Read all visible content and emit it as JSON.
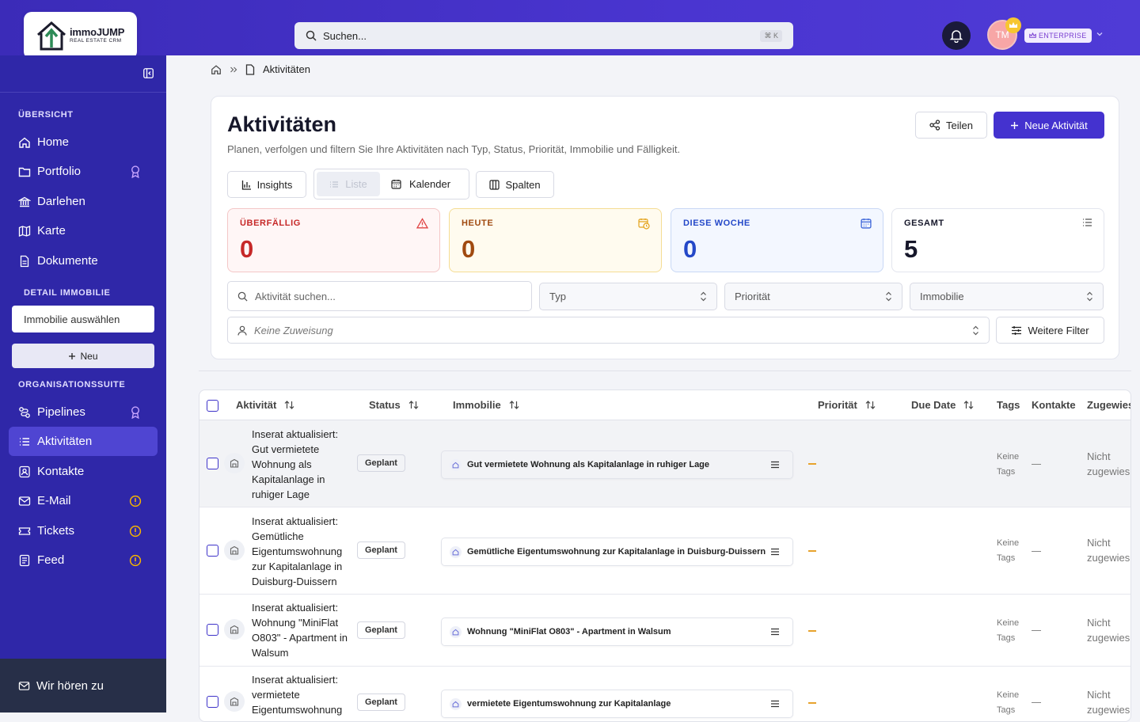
{
  "app": {
    "logo_text": "immoJUMP",
    "logo_subtext": "REAL ESTATE CRM"
  },
  "topbar": {
    "search_placeholder": "Suchen...",
    "search_shortcut": "⌘ K",
    "avatar_initials": "TM",
    "plan_badge": "ENTERPRISE"
  },
  "sidebar": {
    "section_overview": "ÜBERSICHT",
    "overview_items": [
      {
        "label": "Home",
        "icon": "home-icon"
      },
      {
        "label": "Portfolio",
        "icon": "folder-icon",
        "badge": "premium"
      },
      {
        "label": "Darlehen",
        "icon": "bank-icon"
      },
      {
        "label": "Karte",
        "icon": "map-icon"
      },
      {
        "label": "Dokumente",
        "icon": "document-icon"
      }
    ],
    "section_detail": "DETAIL IMMOBILIE",
    "property_select_placeholder": "Immobilie auswählen",
    "new_button": "Neu",
    "section_org": "ORGANISATIONSSUITE",
    "org_items": [
      {
        "label": "Pipelines",
        "icon": "pipeline-icon",
        "badge": "premium"
      },
      {
        "label": "Aktivitäten",
        "icon": "list-icon",
        "active": true
      },
      {
        "label": "Kontakte",
        "icon": "contact-icon"
      },
      {
        "label": "E-Mail",
        "icon": "mail-icon",
        "badge": "warning"
      },
      {
        "label": "Tickets",
        "icon": "ticket-icon",
        "badge": "warning"
      },
      {
        "label": "Feed",
        "icon": "feed-icon",
        "badge": "warning"
      }
    ],
    "feedback_label": "Wir hören zu"
  },
  "breadcrumb": {
    "current": "Aktivitäten"
  },
  "page": {
    "title": "Aktivitäten",
    "subtitle": "Planen, verfolgen und filtern Sie Ihre Aktivitäten nach Typ, Status, Priorität, Immobilie und Fälligkeit.",
    "share_button": "Teilen",
    "new_activity_button": "Neue Aktivität",
    "view_insights": "Insights",
    "view_list": "Liste",
    "view_calendar": "Kalender",
    "view_columns": "Spalten"
  },
  "stats": [
    {
      "label": "ÜBERFÄLLIG",
      "value": "0",
      "color": "#c62828"
    },
    {
      "label": "HEUTE",
      "value": "0",
      "color": "#a04a10"
    },
    {
      "label": "DIESE WOCHE",
      "value": "0",
      "color": "#2448c8"
    },
    {
      "label": "GESAMT",
      "value": "5",
      "color": "#16172a"
    }
  ],
  "filters": {
    "search_placeholder": "Aktivität suchen...",
    "type": "Typ",
    "priority": "Priorität",
    "property": "Immobilie",
    "assignee_placeholder": "Keine Zuweisung",
    "more_filters": "Weitere Filter"
  },
  "table": {
    "columns": [
      "Aktivität",
      "Status",
      "Immobilie",
      "Priorität",
      "Due Date",
      "Tags",
      "Kontakte",
      "Zugewies"
    ],
    "rows": [
      {
        "title": "Inserat aktualisiert: Gut vermietete Wohnung als Kapitalanlage in ruhiger Lage",
        "status": "Geplant",
        "property": "Gut vermietete Wohnung als Kapitalanlage in ruhiger Lage",
        "tags_line1": "Keine",
        "tags_line2": "Tags",
        "assignee_line1": "Nicht",
        "assignee_line2": "zugewies"
      },
      {
        "title": "Inserat aktualisiert: Gemütliche Eigentumswohnung zur Kapitalanlage in Duisburg-Duissern",
        "status": "Geplant",
        "property": "Gemütliche Eigentumswohnung zur Kapitalanlage in Duisburg-Duissern",
        "tags_line1": "Keine",
        "tags_line2": "Tags",
        "assignee_line1": "Nicht",
        "assignee_line2": "zugewies"
      },
      {
        "title": "Inserat aktualisiert: Wohnung \"MiniFlat O803\" - Apartment in Walsum",
        "status": "Geplant",
        "property": "Wohnung \"MiniFlat O803\" - Apartment in Walsum",
        "tags_line1": "Keine",
        "tags_line2": "Tags",
        "assignee_line1": "Nicht",
        "assignee_line2": "zugewies"
      },
      {
        "title": "Inserat aktualisiert: vermietete Eigentumswohnung",
        "status": "Geplant",
        "property": "vermietete Eigentumswohnung zur Kapitalanlage",
        "tags_line1": "Keine",
        "tags_line2": "Tags",
        "assignee_line1": "Nicht",
        "assignee_line2": "zugewies"
      }
    ]
  },
  "colors": {
    "topbar": "#4a35d0",
    "sidebar": "#2f27a8",
    "primary": "#4432cf",
    "warning": "#f5b400"
  }
}
